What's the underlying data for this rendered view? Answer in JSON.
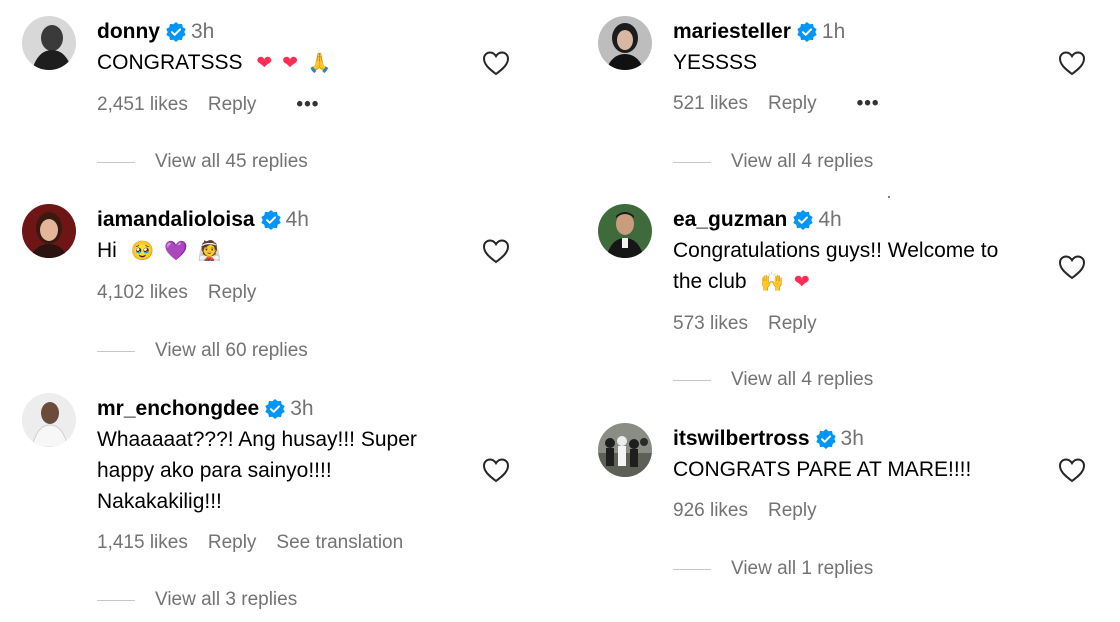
{
  "colors": {
    "verified": "#0095f6",
    "secondary_text": "#737373",
    "divider": "#c7c7c7"
  },
  "icons": {
    "verified": "verified-badge-icon",
    "like": "heart-outline-icon",
    "more": "more-options-icon"
  },
  "left": [
    {
      "username": "donny",
      "time": "3h",
      "text": "CONGRATSSS",
      "emojis": [
        "❤",
        "❤",
        "🙏"
      ],
      "likes": "2,451 likes",
      "reply": "Reply",
      "more": "•••",
      "view_replies": "View all 45 replies"
    },
    {
      "username": "iamandalioloisa",
      "time": "4h",
      "text": "Hi",
      "emojis": [
        "🥹",
        "💜",
        "👰"
      ],
      "likes": "4,102 likes",
      "reply": "Reply",
      "view_replies": "View all 60 replies"
    },
    {
      "username": "mr_enchongdee",
      "time": "3h",
      "text_lines": [
        "Whaaaaat???! Ang husay!!! Super",
        "happy ako para sainyo!!!!",
        "Nakakakilig!!!"
      ],
      "likes": "1,415 likes",
      "reply": "Reply",
      "translation": "See translation",
      "view_replies": "View all 3 replies"
    }
  ],
  "right": [
    {
      "username": "mariesteller",
      "time": "1h",
      "text": "YESSSS",
      "likes": "521 likes",
      "reply": "Reply",
      "more": "•••",
      "view_replies": "View all 4 replies"
    },
    {
      "username": "ea_guzman",
      "time": "4h",
      "text_lines": [
        "Congratulations guys!! Welcome to",
        "the club"
      ],
      "emojis": [
        "🙌",
        "❤"
      ],
      "likes": "573 likes",
      "reply": "Reply",
      "view_replies": "View all 4 replies"
    },
    {
      "username": "itswilbertross",
      "time": "3h",
      "text": "CONGRATS PARE AT MARE!!!!",
      "likes": "926 likes",
      "reply": "Reply",
      "view_replies": "View all 1 replies"
    }
  ]
}
